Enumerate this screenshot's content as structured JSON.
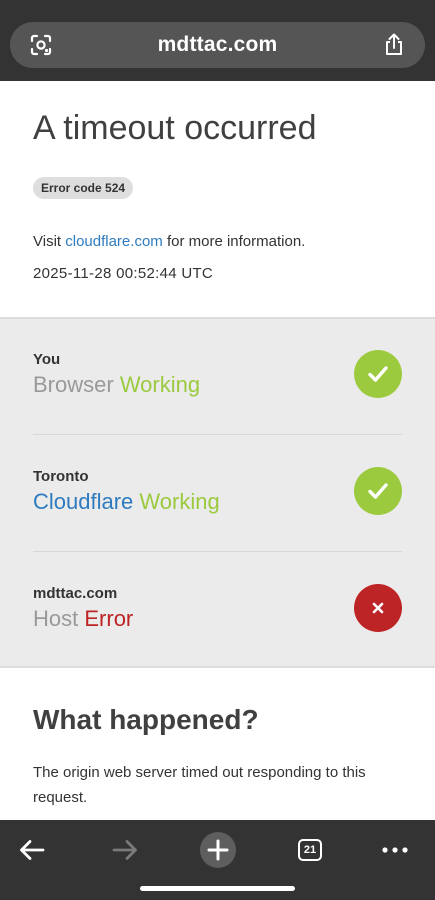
{
  "browser": {
    "url": "mdttac.com",
    "tab_count": "21"
  },
  "header": {
    "title": "A timeout occurred",
    "error_code": "Error code 524",
    "visit_prefix": "Visit ",
    "visit_link": "cloudflare.com",
    "visit_suffix": " for more information.",
    "timestamp": "2025-11-28 00:52:44 UTC"
  },
  "status": {
    "rows": [
      {
        "location": "You",
        "name": "Browser",
        "state": "Working",
        "ok": true
      },
      {
        "location": "Toronto",
        "name": "Cloudflare",
        "state": "Working",
        "ok": true
      },
      {
        "location": "mdttac.com",
        "name": "Host",
        "state": "Error",
        "ok": false
      }
    ]
  },
  "what_happened": {
    "heading": "What happened?",
    "body": "The origin web server timed out responding to this request."
  },
  "colors": {
    "ok": "#9bca3e",
    "error": "#bd2426",
    "link": "#2f7bbf",
    "chrome_bar": "#333333"
  },
  "icons": {
    "lens": "lens-icon",
    "share": "share-icon",
    "back": "back-arrow-icon",
    "forward": "forward-arrow-icon",
    "new_tab": "plus-icon",
    "tabs": "tabs-icon",
    "more": "more-icon",
    "ok": "check-icon",
    "error": "x-icon"
  }
}
